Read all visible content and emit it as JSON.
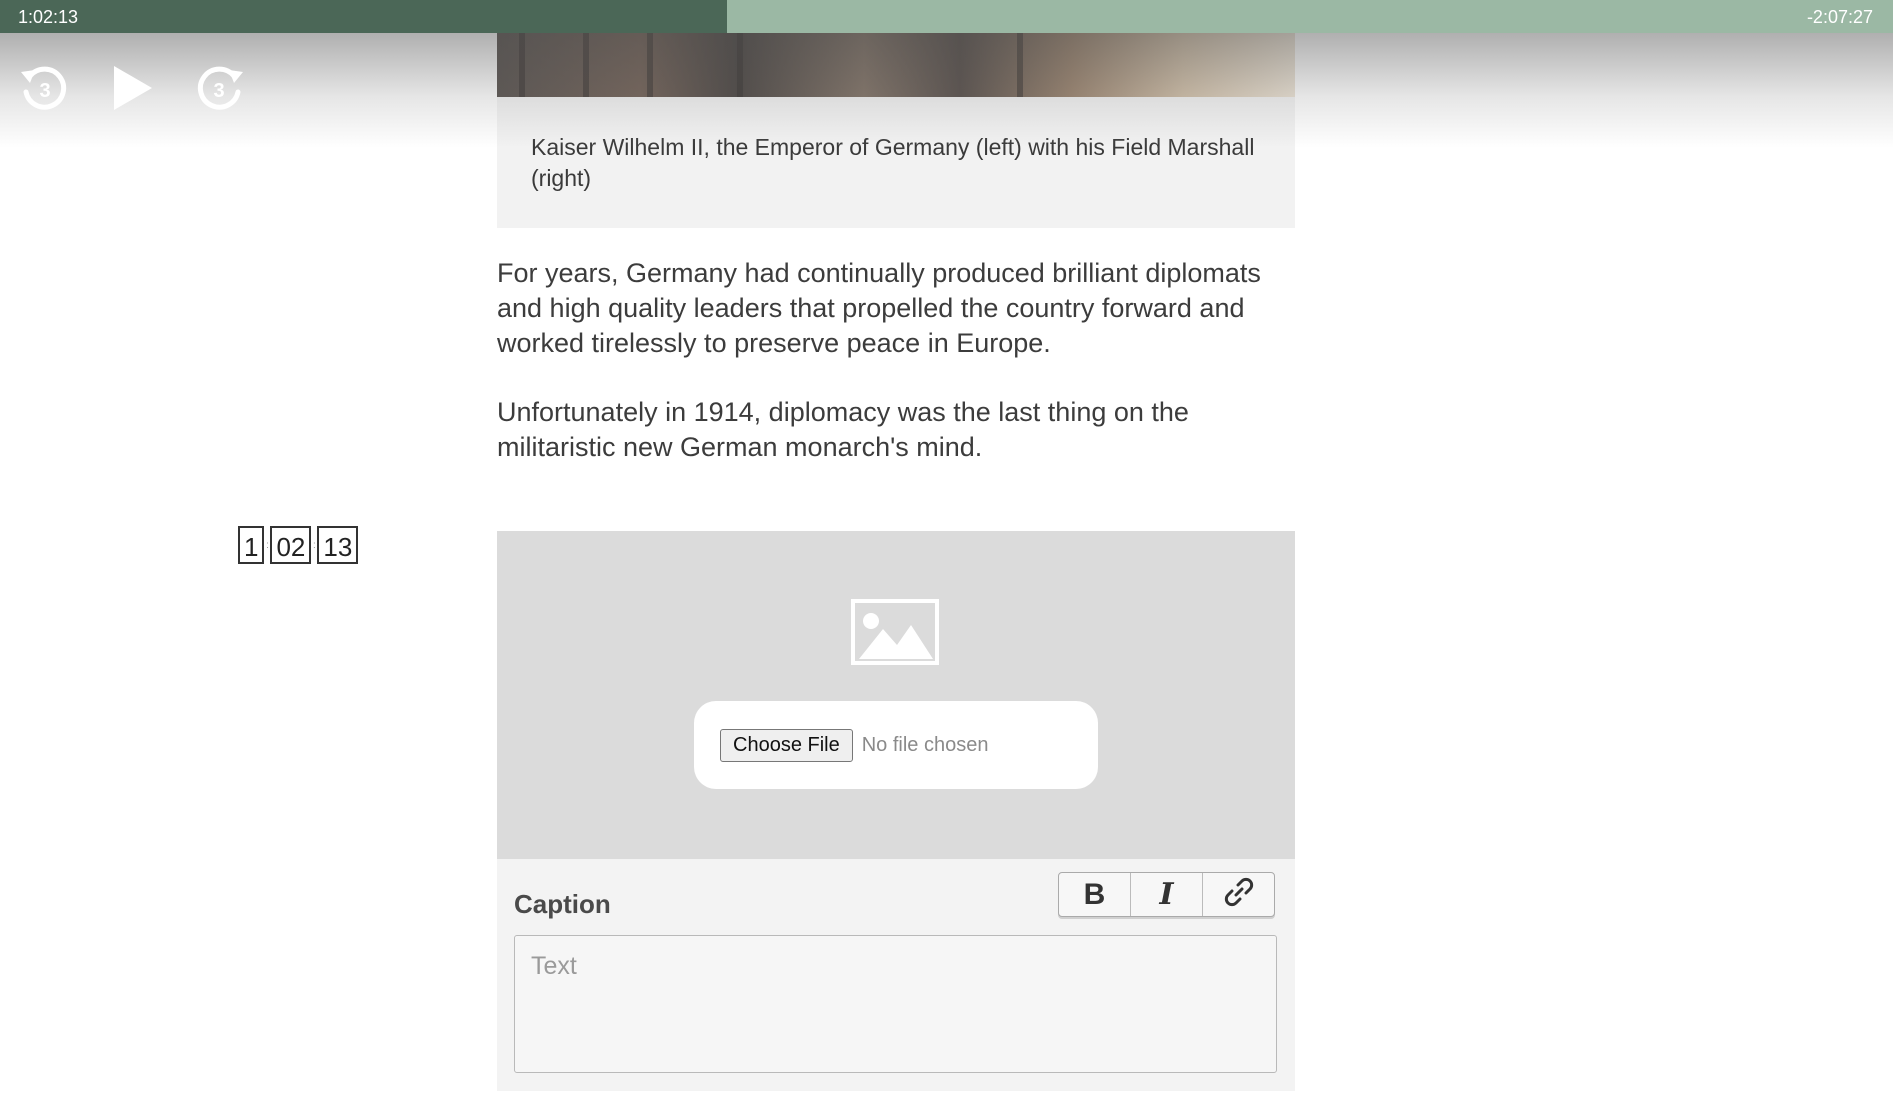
{
  "player": {
    "elapsed": "1:02:13",
    "remaining": "-2:07:27",
    "progress_fraction": 0.3838,
    "controls": {
      "back": {
        "icon": "rewind-3-icon",
        "label": "3"
      },
      "play": {
        "icon": "play-icon"
      },
      "forward": {
        "icon": "forward-3-icon",
        "label": "3"
      }
    }
  },
  "article": {
    "image_caption": "Kaiser Wilhelm II, the Emperor of Germany (left) with his Field Marshall (right)",
    "paragraphs": [
      "For years, Germany had continually produced brilliant diplomats and high quality leaders that propelled the country forward and worked tirelessly to preserve peace in Europe.",
      "Unfortunately in 1914, diplomacy was the last thing on the militaristic new German monarch's mind."
    ]
  },
  "timestamp": {
    "hours": "1",
    "minutes": "02",
    "seconds": "13"
  },
  "upload": {
    "icon": "image-placeholder-icon",
    "choose_label": "Choose File",
    "status": "No file chosen"
  },
  "caption_editor": {
    "label": "Caption",
    "bold_label": "B",
    "italic_label": "I",
    "link_icon": "link-icon",
    "placeholder": "Text"
  },
  "colors": {
    "progress_track": "#9bb8a4",
    "progress_fill": "#4b6757"
  }
}
